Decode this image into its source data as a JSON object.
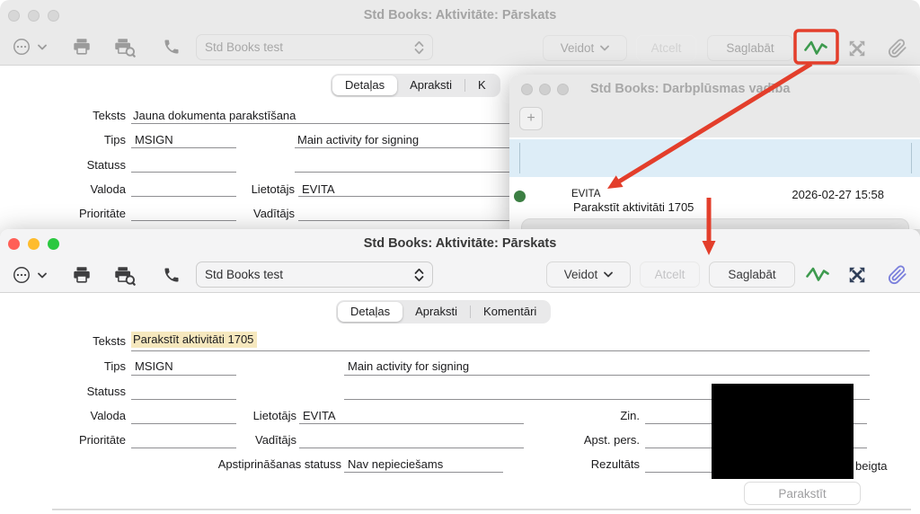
{
  "back_window": {
    "title": "Std Books: Aktivitāte: Pārskats",
    "toolbar": {
      "paste_special_value": "Std Books test",
      "veidot_label": "Veidot",
      "atcelt_label": "Atcelt",
      "saglabat_label": "Saglabāt"
    },
    "tabs": [
      {
        "label": "Detaļas",
        "selected": true
      },
      {
        "label": "Apraksti",
        "selected": false
      },
      {
        "label": "K",
        "selected": false
      }
    ],
    "fields": {
      "teksts_label": "Teksts",
      "teksts_value": "Jauna dokumenta parakstīšana",
      "tips_label": "Tips",
      "tips_value": "MSIGN",
      "tips_description": "Main activity for signing",
      "statuss_label": "Statuss",
      "valoda_label": "Valoda",
      "lietotajs_label": "Lietotājs",
      "lietotajs_value": "EVITA",
      "prioritate_label": "Prioritāte",
      "vaditajs_label": "Vadītājs"
    }
  },
  "workflow_window": {
    "title": "Std Books: Darbplūsmas vadība",
    "add_button_label": "+",
    "entry": {
      "user": "EVITA",
      "task": "Parakstīt aktivitāti 1705",
      "datetime": "2026-02-27 15:58"
    }
  },
  "front_window": {
    "title": "Std Books: Aktivitāte: Pārskats",
    "toolbar": {
      "paste_special_value": "Std Books test",
      "veidot_label": "Veidot",
      "atcelt_label": "Atcelt",
      "saglabat_label": "Saglabāt"
    },
    "tabs": [
      {
        "label": "Detaļas",
        "selected": true
      },
      {
        "label": "Apraksti",
        "selected": false
      },
      {
        "label": "Komentāri",
        "selected": false
      }
    ],
    "fields": {
      "teksts_label": "Teksts",
      "teksts_value": "Parakstīt aktivitāti 1705",
      "tips_label": "Tips",
      "tips_value": "MSIGN",
      "tips_description": "Main activity for signing",
      "statuss_label": "Statuss",
      "valoda_label": "Valoda",
      "lietotajs_label": "Lietotājs",
      "lietotajs_value": "EVITA",
      "zin_label": "Zin.",
      "prioritate_label": "Prioritāte",
      "vaditajs_label": "Vadītājs",
      "apst_pers_label": "Apst. pers.",
      "apstiprinasanas_label": "Apstiprināšanas statuss",
      "apstiprinasanas_value": "Nav nepieciešams",
      "rezultats_label": "Rezultāts",
      "pabeigta_partial": "beigta"
    },
    "parakstit_button": "Parakstīt"
  },
  "colors": {
    "annotation_red": "#E33E2B",
    "pulse_green": "#3D9A4E",
    "highlight_yellow": "#F6E8BE",
    "paperclip_violet": "#7B80DC",
    "expand_navy": "#2F3E58",
    "status_dot_green": "#3C7F43"
  }
}
